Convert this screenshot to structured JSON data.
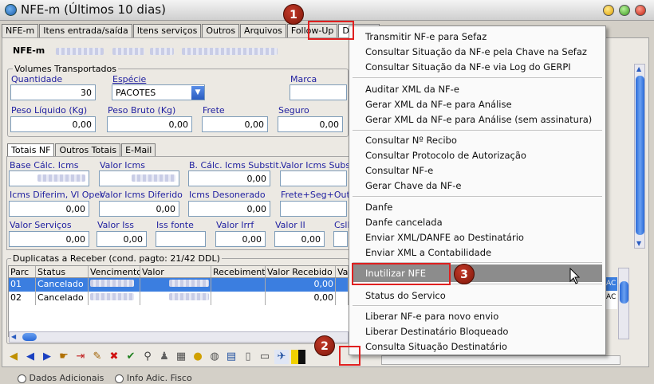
{
  "window": {
    "title": "NFE-m (Últimos 10 dias)"
  },
  "tabs": [
    "NFE-m",
    "Itens entrada/saída",
    "Itens serviços",
    "Outros",
    "Arquivos",
    "Follow-Up",
    "Dados Ad"
  ],
  "header": {
    "label": "NFE-m"
  },
  "volumes": {
    "group_title": "Volumes Transportados",
    "quantidade_label": "Quantidade",
    "quantidade_value": "30",
    "especie_label": "Espécie",
    "especie_value": "PACOTES",
    "marca_label": "Marca",
    "peso_liquido_label": "Peso Líquido (Kg)",
    "peso_liquido_value": "0,00",
    "peso_bruto_label": "Peso Bruto (Kg)",
    "peso_bruto_value": "0,00",
    "frete_label": "Frete",
    "frete_value": "0,00",
    "seguro_label": "Seguro",
    "seguro_value": "0,00"
  },
  "subtabs": [
    "Totais NF",
    "Outros Totais",
    "E-Mail"
  ],
  "totais": {
    "base_calc_icms": "Base Cálc. Icms",
    "valor_icms": "Valor Icms",
    "b_calc_icms_subst": "B. Cálc. Icms Substit.",
    "b_calc_icms_subst_value": "0,00",
    "valor_icms_subst": "Valor Icms Substi",
    "icms_diferim": "Icms Diferim, Vl Oper",
    "icms_diferim_value": "0,00",
    "valor_icms_diferido": "Valor Icms Diferido",
    "valor_icms_diferido_value": "0,00",
    "icms_desonerado": "Icms Desonerado",
    "icms_desonerado_value": "0,00",
    "frete_seg_outra": "Frete+Seg+Outra",
    "valor_servicos": "Valor Serviços",
    "valor_servicos_value": "0,00",
    "valor_iss": "Valor Iss",
    "valor_iss_value": "0,00",
    "iss_fonte": "Iss fonte",
    "valor_irrf": "Valor Irrf",
    "valor_irrf_value": "0,00",
    "valor_ii": "Valor II",
    "valor_ii_value": "0,00",
    "csll": "Csll"
  },
  "duplicatas": {
    "title": "Duplicatas a Receber (cond. pagto: 21/42 DDL)",
    "columns": [
      "Parc",
      "Status",
      "Vencimento",
      "Valor",
      "Recebimento",
      "Valor Recebido",
      "Va"
    ],
    "rows": [
      {
        "parc": "01",
        "status": "Cancelado",
        "valor_recebido": "0,00"
      },
      {
        "parc": "02",
        "status": "Cancelado",
        "valor_recebido": "0,00"
      }
    ]
  },
  "menu": {
    "items": [
      "Transmitir NF-e para Sefaz",
      "Consultar Situação da NF-e pela Chave na Sefaz",
      "Consultar Situação da NF-e via Log do GERPI",
      "Auditar XML da NF-e",
      "Gerar XML da NF-e para Análise",
      "Gerar XML da NF-e para Análise (sem assinatura)",
      "Consultar Nº Recibo",
      "Consultar Protocolo de Autorização",
      "Consultar NF-e",
      "Gerar Chave da NF-e",
      "Danfe",
      "Danfe cancelada",
      "Enviar XML/DANFE ao Destinatário",
      "Enviar XML a Contabilidade",
      "Inutilizar NFE",
      "Status do Servico",
      "Liberar NF-e para novo envio",
      "Liberar Destinatário Bloqueado",
      "Consulta Situação Destinatário"
    ],
    "highlighted": "Inutilizar NFE"
  },
  "badges": [
    "1",
    "2",
    "3"
  ],
  "bottom": {
    "option1": "Dados Adicionais",
    "option2": "Info Adic. Fisco"
  },
  "colors": {
    "accent": "#3b7ee0",
    "label_blue": "#1f1fa0",
    "annotation_red": "#e02020"
  }
}
